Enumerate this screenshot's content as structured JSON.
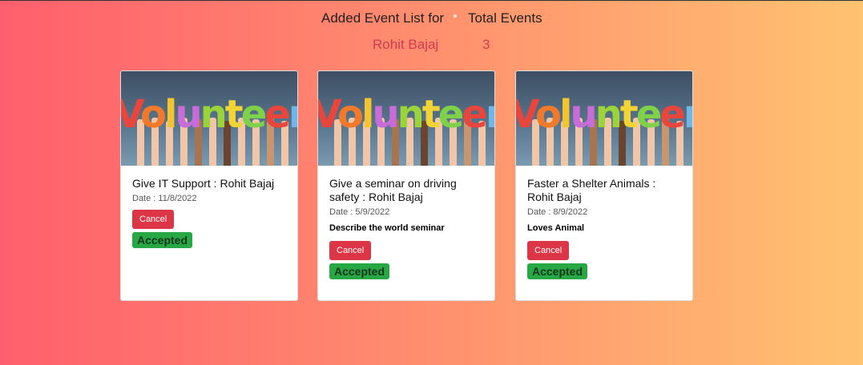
{
  "header": {
    "title": "Added Event List for",
    "total_label": "Total Events",
    "user_name": "Rohit Bajaj",
    "event_count": "3"
  },
  "colors": {
    "gradient_start": "#ff5f6d",
    "gradient_end": "#ffc371",
    "cancel_red": "#dc3545",
    "accepted_green": "#28a745",
    "name_red": "#d43a4f"
  },
  "image_word": "Volunteer",
  "cards": [
    {
      "title": "Give IT Support : Rohit Bajaj",
      "date": "Date : 11/8/2022",
      "description": "",
      "cancel_label": "Cancel",
      "status": "Accepted"
    },
    {
      "title": "Give a seminar on driving safety : Rohit Bajaj",
      "date": "Date : 5/9/2022",
      "description": "Describe the world seminar",
      "cancel_label": "Cancel",
      "status": "Accepted"
    },
    {
      "title": "Faster a Shelter Animals : Rohit Bajaj",
      "date": "Date : 8/9/2022",
      "description": "Loves Animal",
      "cancel_label": "Cancel",
      "status": "Accepted"
    }
  ]
}
